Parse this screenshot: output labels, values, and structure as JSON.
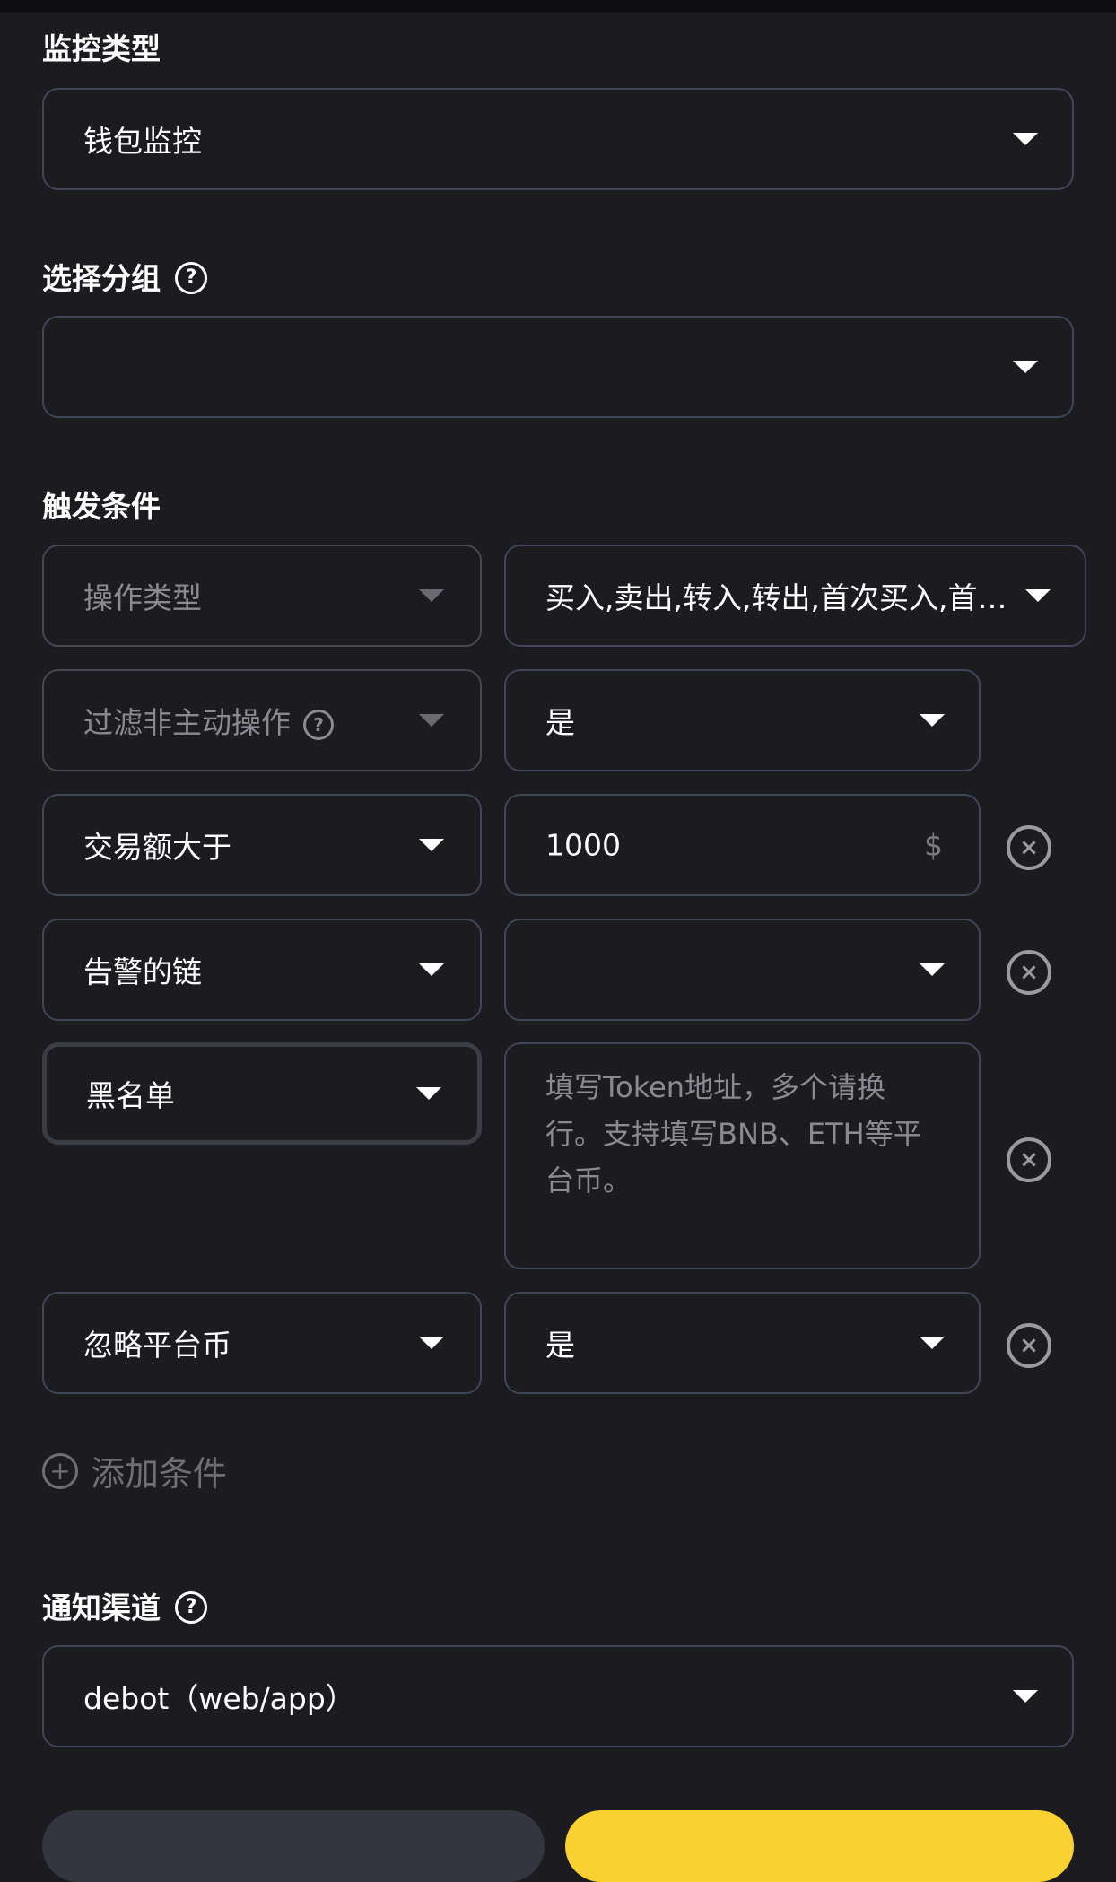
{
  "monitor_type": {
    "label": "监控类型",
    "value": "钱包监控"
  },
  "group": {
    "label": "选择分组",
    "value": ""
  },
  "trigger": {
    "label": "触发条件",
    "rows": [
      {
        "field": "操作类型",
        "value": "买入,卖出,转入,转出,首次买入,首…"
      },
      {
        "field": "过滤非主动操作",
        "value": "是"
      },
      {
        "field": "交易额大于",
        "value": "1000",
        "unit": "$"
      },
      {
        "field": "告警的链",
        "value": ""
      },
      {
        "field": "黑名单",
        "placeholder": "填写Token地址，多个请换行。支持填写BNB、ETH等平台币。"
      },
      {
        "field": "忽略平台币",
        "value": "是"
      }
    ],
    "add_label": "添加条件"
  },
  "notify": {
    "label": "通知渠道",
    "value": "debot（web/app）"
  },
  "icons": {
    "help": "question-circle-icon",
    "caret": "caret-down-icon",
    "remove": "close-circle-icon",
    "add": "plus-circle-icon"
  },
  "colors": {
    "background": "#1b1b20",
    "border": "#3e4657",
    "confirm": "#f9d231"
  }
}
